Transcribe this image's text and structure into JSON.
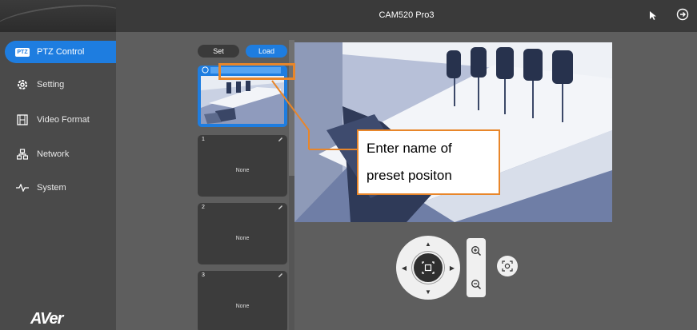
{
  "header": {
    "title": "CAM520 Pro3"
  },
  "sidebar": {
    "items": [
      {
        "label": "PTZ Control",
        "icon": "ptz-icon",
        "badge": "PTZ",
        "active": true
      },
      {
        "label": "Setting",
        "icon": "gear-icon"
      },
      {
        "label": "Video Format",
        "icon": "film-icon"
      },
      {
        "label": "Network",
        "icon": "network-icon"
      },
      {
        "label": "System",
        "icon": "pulse-icon"
      }
    ],
    "brand": "AVer"
  },
  "presets": {
    "set_label": "Set",
    "load_label": "Load",
    "cards": [
      {
        "number": "0",
        "content": ""
      },
      {
        "number": "1",
        "content": "None"
      },
      {
        "number": "2",
        "content": "None"
      },
      {
        "number": "3",
        "content": "None"
      }
    ]
  },
  "callout": {
    "line1": "Enter name of",
    "line2": "preset positon"
  },
  "colors": {
    "accent": "#1e7de0",
    "callout_border": "#e8862a",
    "background": "#5e5e5e",
    "sidebar": "#4a4a4a"
  },
  "controls": {
    "dpad_icons": [
      "arrow-up-icon",
      "arrow-down-icon",
      "arrow-left-icon",
      "arrow-right-icon",
      "home-icon"
    ],
    "zoom_icons": [
      "zoom-in-icon",
      "zoom-out-icon"
    ],
    "focus_icon": "focus-icon"
  }
}
